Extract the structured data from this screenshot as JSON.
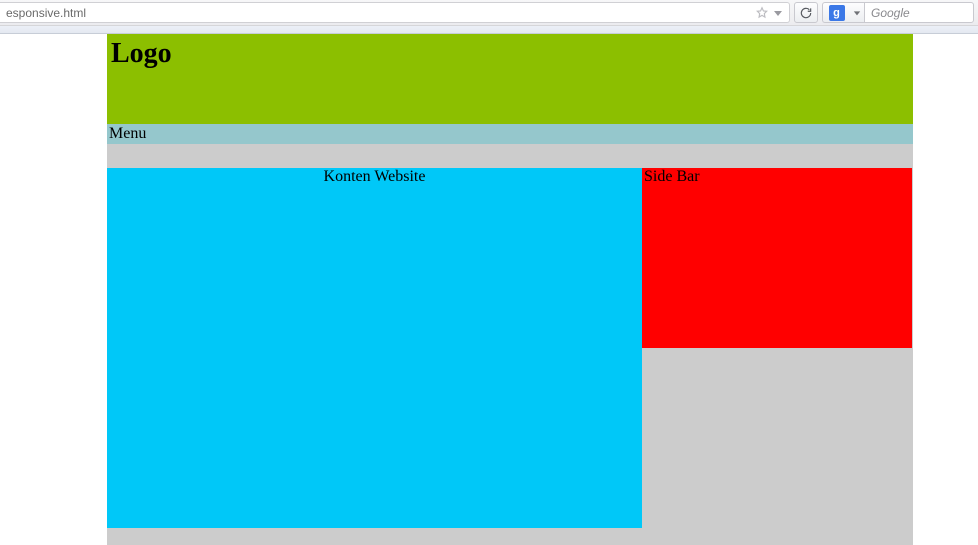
{
  "browser": {
    "url_fragment": "esponsive.html",
    "search_placeholder": "Google",
    "search_engine_badge": "g"
  },
  "page": {
    "header": {
      "logo": "Logo"
    },
    "menu": {
      "label": "Menu"
    },
    "content": {
      "title": "Konten Website"
    },
    "sidebar": {
      "title": "Side Bar"
    }
  },
  "colors": {
    "header_bg": "#8cbf00",
    "menu_bg": "#95c7cc",
    "content_bg": "#00c8f8",
    "sidebar_bg": "#ff0000",
    "page_bg": "#cccccc"
  }
}
